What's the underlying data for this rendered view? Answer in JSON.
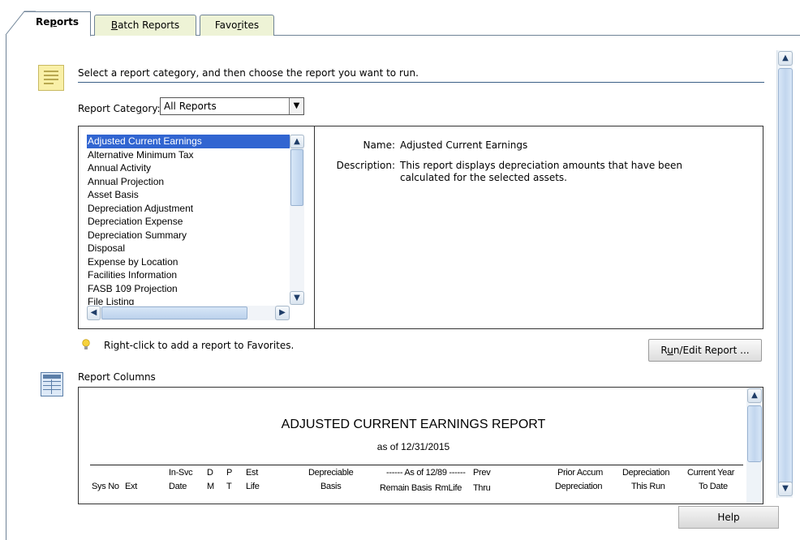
{
  "tabs": [
    {
      "label": "Reports",
      "underline_index": 2
    },
    {
      "label": "Batch Reports",
      "underline_index": 0
    },
    {
      "label": "Favorites",
      "underline_index": 4
    }
  ],
  "instruction": "Select a report category, and then choose the report you want to run.",
  "category": {
    "label_pre": "Report Cate",
    "label_u": "g",
    "label_post": "ory:",
    "selected": "All Reports"
  },
  "reports": {
    "items": [
      "Adjusted Current Earnings",
      "Alternative Minimum Tax",
      "Annual Activity",
      "Annual Projection",
      "Asset Basis",
      "Depreciation Adjustment",
      "Depreciation Expense",
      "Depreciation Summary",
      "Disposal",
      "Expense by Location",
      "Facilities Information",
      "FASB 109 Projection",
      "File Listing"
    ],
    "selected_index": 0
  },
  "details": {
    "name_label": "Name:",
    "name_value": "Adjusted Current Earnings",
    "desc_label": "Description:",
    "desc_line1": "This report displays depreciation amounts that have been",
    "desc_line2": "calculated for the selected assets."
  },
  "tip": "Right-click to add a report to Favorites.",
  "run_button": {
    "pre": "R",
    "u": "u",
    "post": "n/Edit Report ..."
  },
  "columns_label": "Report Columns",
  "preview": {
    "title": "ADJUSTED CURRENT EARNINGS REPORT",
    "subtitle": "as of 12/31/2015",
    "headers": {
      "sysno": "Sys No",
      "ext": "Ext",
      "insvc_1": "In-Svc",
      "insvc_2": "Date",
      "d_1": "D",
      "d_2": "M",
      "p_1": "P",
      "p_2": "T",
      "est_1": "Est",
      "est_2": "Life",
      "dep_1": "Depreciable",
      "dep_2": "Basis",
      "asof": "------ As of 12/89 ------",
      "remain": "Remain Basis",
      "rmlife": "RmLife",
      "prev_1": "Prev",
      "prev_2": "Thru",
      "prior_1": "Prior Accum",
      "prior_2": "Depreciation",
      "thisrun_1": "Depreciation",
      "thisrun_2": "This Run",
      "cur_1": "Current Year",
      "cur_2": "To Date"
    }
  },
  "help_button": "Help",
  "colors": {
    "selection": "#3165d1",
    "tab_bg": "#eef3d6",
    "rule": "#3b5f86"
  }
}
